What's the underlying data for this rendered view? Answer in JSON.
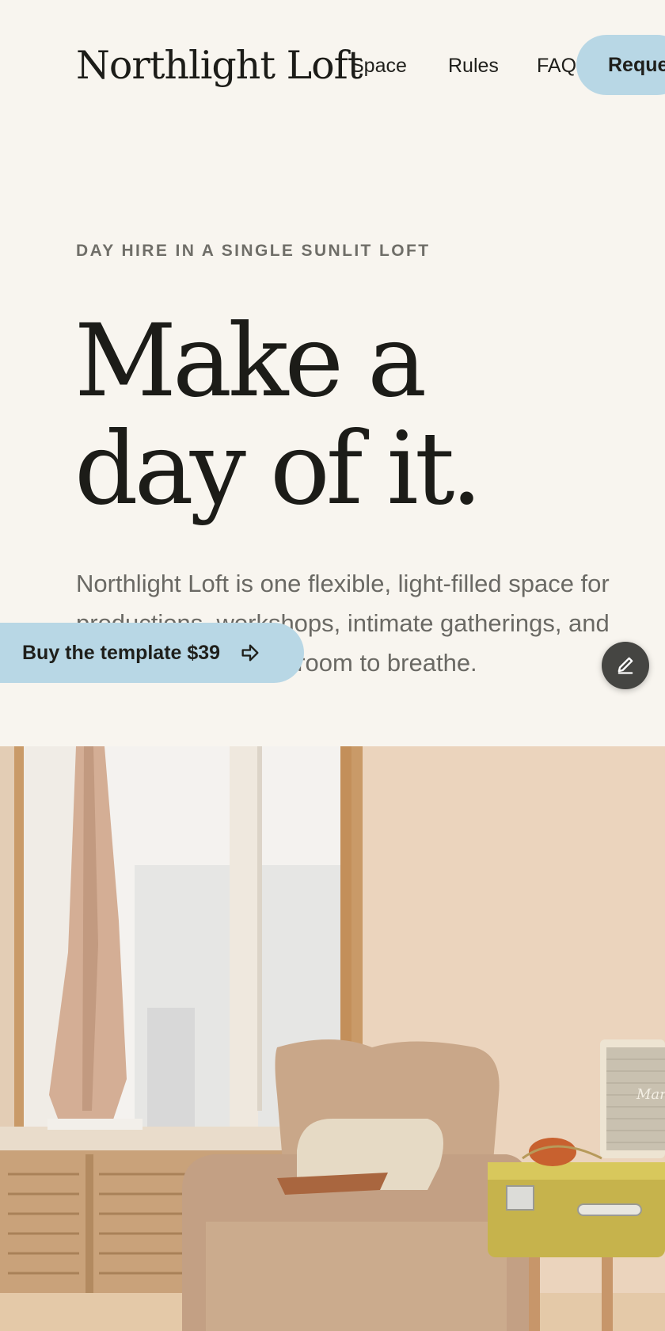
{
  "header": {
    "brand": "Northlight Loft",
    "nav": [
      {
        "label": "Space"
      },
      {
        "label": "Rules"
      },
      {
        "label": "FAQ"
      }
    ],
    "cta_label": "Request"
  },
  "hero": {
    "eyebrow": "DAY HIRE IN A SINGLE SUNLIT LOFT",
    "title_line1": "Make a",
    "title_line2": "day of it.",
    "description": "Northlight Loft is one flexible, light-filled space for productions, workshops, intimate gatherings, and anything that needs room to breathe."
  },
  "floating": {
    "buy_label": "Buy the template $39",
    "buy_icon": "arrow-right-icon",
    "edit_icon": "pencil-icon"
  },
  "photo": {
    "speaker_brand": "Marshall"
  },
  "colors": {
    "background": "#f8f5ef",
    "accent": "#b8d7e5",
    "text": "#1f1f1b",
    "muted": "#6a6964"
  }
}
